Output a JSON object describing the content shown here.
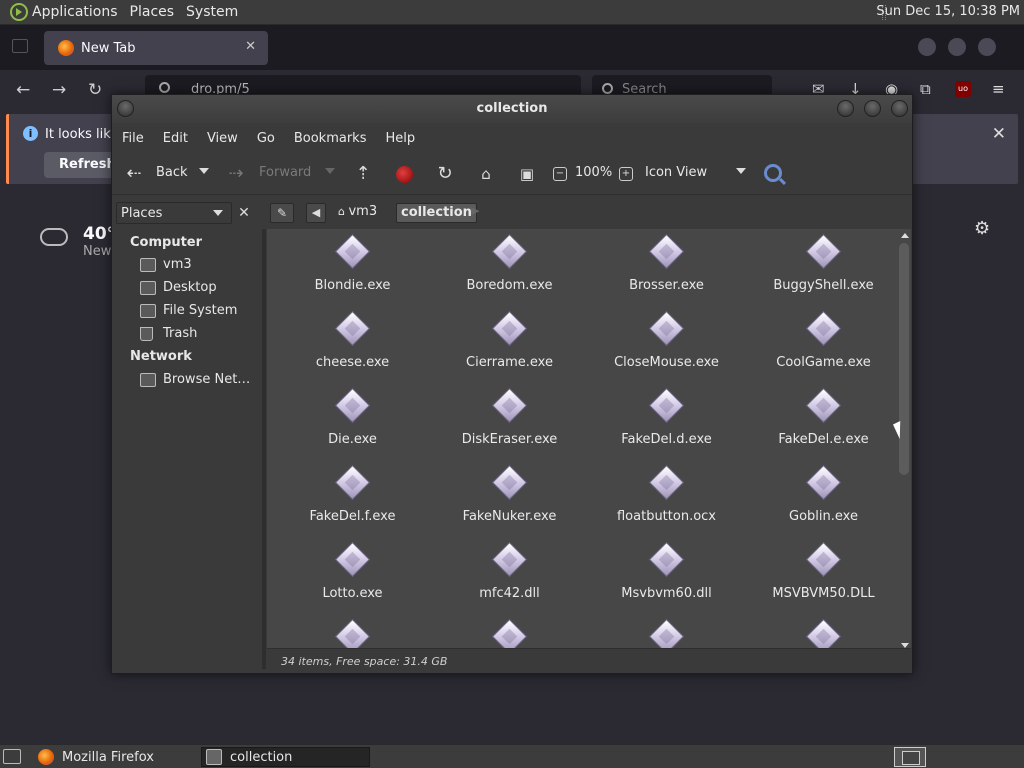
{
  "top_panel": {
    "menus": [
      "Applications",
      "Places",
      "System"
    ],
    "clock": "Sun Dec 15, 10:38 PM"
  },
  "firefox": {
    "tab_title": "New Tab",
    "url_text": "dro.pm/5",
    "search_placeholder": "Search",
    "notification_text": "It looks like",
    "refresh_button": "Refresh F",
    "weather_temp": "40°",
    "weather_location": "New"
  },
  "file_manager": {
    "title": "collection",
    "menu": [
      "File",
      "Edit",
      "View",
      "Go",
      "Bookmarks",
      "Help"
    ],
    "toolbar": {
      "back": "Back",
      "forward": "Forward",
      "zoom": "100%",
      "view_mode": "Icon View"
    },
    "sidebar_selector": "Places",
    "path": [
      "vm3",
      "collection"
    ],
    "sidebar": {
      "computer_heading": "Computer",
      "computer_items": [
        "vm3",
        "Desktop",
        "File System",
        "Trash"
      ],
      "network_heading": "Network",
      "network_items": [
        "Browse Net…"
      ]
    },
    "files": [
      "Blondie.exe",
      "Boredom.exe",
      "Brosser.exe",
      "BuggyShell.exe",
      "cheese.exe",
      "Cierrame.exe",
      "CloseMouse.exe",
      "CoolGame.exe",
      "Die.exe",
      "DiskEraser.exe",
      "FakeDel.d.exe",
      "FakeDel.e.exe",
      "FakeDel.f.exe",
      "FakeNuker.exe",
      "floatbutton.ocx",
      "Goblin.exe",
      "Lotto.exe",
      "mfc42.dll",
      "Msvbvm60.dll",
      "MSVBVM50.DLL",
      "",
      "",
      "",
      ""
    ],
    "status": "34 items, Free space: 31.4 GB"
  },
  "taskbar": {
    "tasks": [
      "Mozilla Firefox",
      "collection"
    ]
  }
}
